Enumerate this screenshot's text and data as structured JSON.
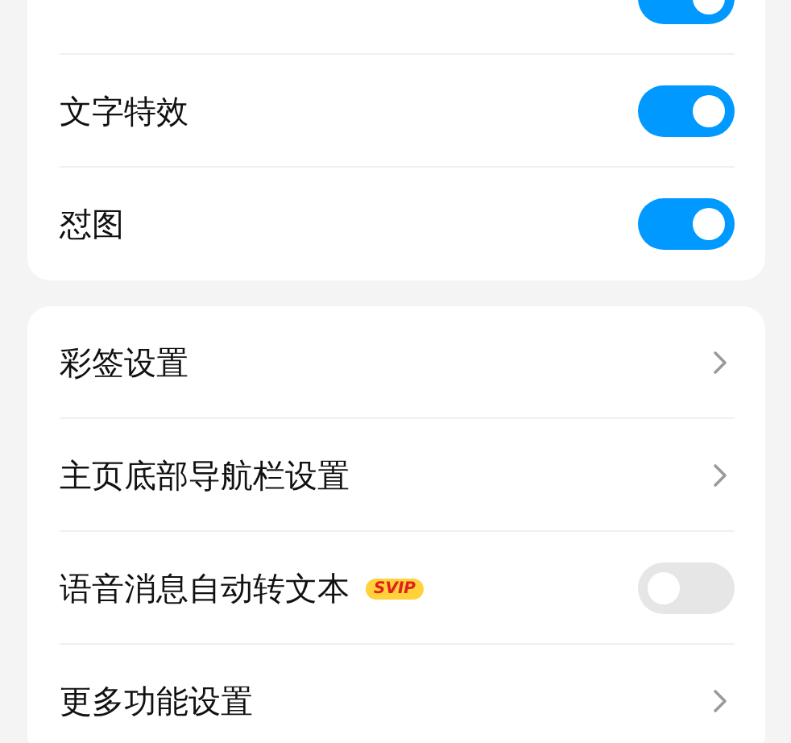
{
  "groups": [
    {
      "items": [
        {
          "kind": "toggle",
          "on": true
        },
        {
          "kind": "toggle",
          "label": "文字特效",
          "on": true
        },
        {
          "kind": "toggle",
          "label": "怼图",
          "on": true
        }
      ]
    },
    {
      "items": [
        {
          "kind": "link",
          "label": "彩签设置"
        },
        {
          "kind": "link",
          "label": "主页底部导航栏设置"
        },
        {
          "kind": "toggle",
          "label": "语音消息自动转文本",
          "badge": "SVIP",
          "on": false
        },
        {
          "kind": "link",
          "label": "更多功能设置"
        }
      ]
    }
  ]
}
